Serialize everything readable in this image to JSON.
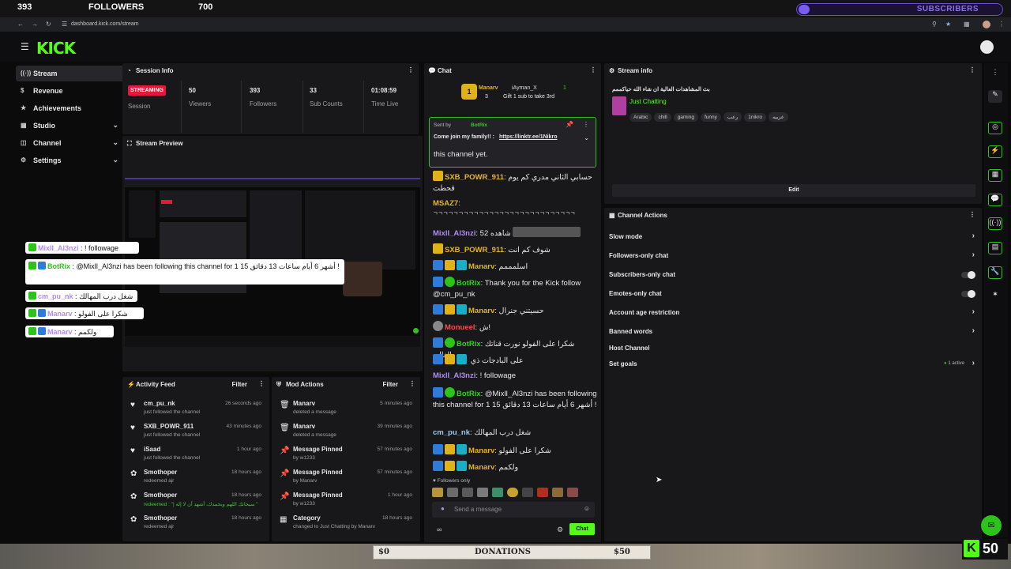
{
  "overlay_top": {
    "followers_count": "393",
    "followers_label": "FOLLOWERS",
    "followers_goal": "700",
    "subscribers_label": "SUBSCRIBERS"
  },
  "browser": {
    "url": "dashboard.kick.com/stream"
  },
  "app": {
    "logo": "KICK"
  },
  "sidebar": {
    "items": [
      {
        "label": "Stream",
        "icon": "broadcast-icon"
      },
      {
        "label": "Revenue",
        "icon": "dollar-icon"
      },
      {
        "label": "Achievements",
        "icon": "trophy-icon"
      },
      {
        "label": "Studio",
        "icon": "studio-icon"
      },
      {
        "label": "Channel",
        "icon": "channel-icon"
      },
      {
        "label": "Settings",
        "icon": "gear-icon"
      }
    ]
  },
  "session": {
    "title": "Session Info",
    "status": "STREAMING",
    "status_label": "Session",
    "viewers": "50",
    "viewers_label": "Viewers",
    "followers": "393",
    "followers_label": "Followers",
    "subs": "33",
    "subs_label": "Sub Counts",
    "time": "01:08:59",
    "time_label": "Time Live"
  },
  "preview": {
    "title": "Stream Preview"
  },
  "activity": {
    "title": "Activity Feed",
    "filter": "Filter",
    "rows": [
      {
        "name": "cm_pu_nk",
        "desc": "just followed the channel",
        "time": "26 seconds ago"
      },
      {
        "name": "SXB_POWR_911",
        "desc": "just followed the channel",
        "time": "43 minutes ago"
      },
      {
        "name": "iSaad",
        "desc": "just followed the channel",
        "time": "1 hour ago"
      },
      {
        "name": "Smothoper",
        "desc": "redeemed ajr",
        "time": "18 hours ago"
      },
      {
        "name": "Smothoper",
        "desc": "redeemed : \"| سبحانك اللهم وبحمدك، أشهد أن لا إله \"",
        "time": "18 hours ago"
      },
      {
        "name": "Smothoper",
        "desc": "redeemed ajr",
        "time": "18 hours ago"
      }
    ]
  },
  "mod": {
    "title": "Mod Actions",
    "filter": "Filter",
    "rows": [
      {
        "name": "Manarv",
        "desc": "deleted a message",
        "time": "5 minutes ago"
      },
      {
        "name": "Manarv",
        "desc": "deleted a message",
        "time": "39 minutes ago"
      },
      {
        "name": "Message Pinned",
        "desc": "by w1233",
        "time": "57 minutes ago"
      },
      {
        "name": "Message Pinned",
        "desc": "by Manarv",
        "time": "57 minutes ago"
      },
      {
        "name": "Message Pinned",
        "desc": "by w1233",
        "time": "1 hour ago"
      },
      {
        "name": "Category",
        "desc": "changed to Just Chatting by Manarv",
        "time": "18 hours ago"
      }
    ]
  },
  "chat": {
    "title": "Chat",
    "top_gifter": "Manarv",
    "top_gifter_count": "3",
    "second": "iAyman_X",
    "second_count": "1",
    "gift_note": "Gift 1 sub to take 3rd",
    "pinned_by": "Sent by",
    "pinned_user": "BotRix",
    "pinned_msg": "Come join my family!! :",
    "pinned_link": "https://linktr.ee/1Nikro",
    "notice": "this channel yet.",
    "lines": [
      {
        "user": "SXB_POWR_911",
        "msg": "حسابي الثاني مدري كم يوم قحطت"
      },
      {
        "user": "MSAZ7",
        "msg": "ᄀᄀᄀᄀᄀᄀᄀᄀᄀᄀᄀᄀᄀᄀᄀᄀᄀᄀᄀᄀᄀᄀᄀᄀᄀᄀᄀᄀ"
      },
      {
        "user": "MixlI_Al3nzi",
        "msg": "52 شاهده"
      },
      {
        "user": "SXB_POWR_911",
        "msg": "شوف كم انت"
      },
      {
        "user": "Manarv",
        "msg": "اسلمممم"
      },
      {
        "user": "BotRix",
        "msg": "Thank you for the Kick follow @cm_pu_nk"
      },
      {
        "user": "Manarv",
        "msg": "حسيتني جنرال"
      },
      {
        "user": "Monueel",
        "msg": "ش!"
      },
      {
        "user": "BotRix",
        "msg": "شكرا على الفولو نورت قناتك يالغالي"
      },
      {
        "user": "",
        "msg": "على البادجات ذي"
      },
      {
        "user": "MixlI_Al3nzi",
        "msg": "! followage"
      },
      {
        "user": "BotRix",
        "msg": "@MixlI_Al3nzi has been following this channel for 1 15 أشهر 6 أيام ساعات 13 دقائق !"
      },
      {
        "user": "cm_pu_nk",
        "msg": "شغل درب المهالك"
      },
      {
        "user": "Manarv",
        "msg": "شكرا على الفولو"
      },
      {
        "user": "Manarv",
        "msg": "ولكمم"
      }
    ],
    "followers_only": "Followers only",
    "placeholder": "Send a message",
    "send": "Chat"
  },
  "stream_info": {
    "title": "Stream info",
    "stream_title": "بث المشاهدات العالية ان شاء الله حياكممم",
    "category": "Just Chatting",
    "tags": [
      "Arabic",
      "chill",
      "gaming",
      "funny",
      "رعب",
      "1nikro",
      "عربيه"
    ],
    "edit": "Edit"
  },
  "channel_actions": {
    "title": "Channel Actions",
    "rows": [
      {
        "label": "Slow mode",
        "kind": "arrow"
      },
      {
        "label": "Followers-only chat",
        "kind": "arrow"
      },
      {
        "label": "Subscribers-only chat",
        "kind": "toggle"
      },
      {
        "label": "Emotes-only chat",
        "kind": "toggle"
      },
      {
        "label": "Account age restriction",
        "kind": "arrow"
      },
      {
        "label": "Banned words",
        "kind": "arrow"
      },
      {
        "label": "Host Channel",
        "kind": "none"
      },
      {
        "label": "Set goals",
        "kind": "arrow"
      }
    ],
    "goals_badge": "1 active"
  },
  "overlay_chat": [
    {
      "user": "MixlI_Al3nzi",
      "msg": ": ! followage"
    },
    {
      "user": "BotRix",
      "msg": ": @MixlI_Al3nzi has been following this channel for 1 15 أشهر 6 أيام ساعات 13 دقائق !"
    },
    {
      "user": "cm_pu_nk",
      "msg": ": شغل درب المهالك"
    },
    {
      "user": "Manarv",
      "msg": ": شكرا على الفولو"
    },
    {
      "user": "Manarv",
      "msg": ": ولكمم"
    }
  ],
  "bottom_overlay": {
    "left_amount": "$0",
    "donations": "DONATIONS",
    "right_amount": "$50",
    "viewer_count": "50"
  },
  "colors": {
    "kick_green": "#53fc18",
    "streaming_red": "#e3193b",
    "accent_purple": "#7b5cf0"
  }
}
